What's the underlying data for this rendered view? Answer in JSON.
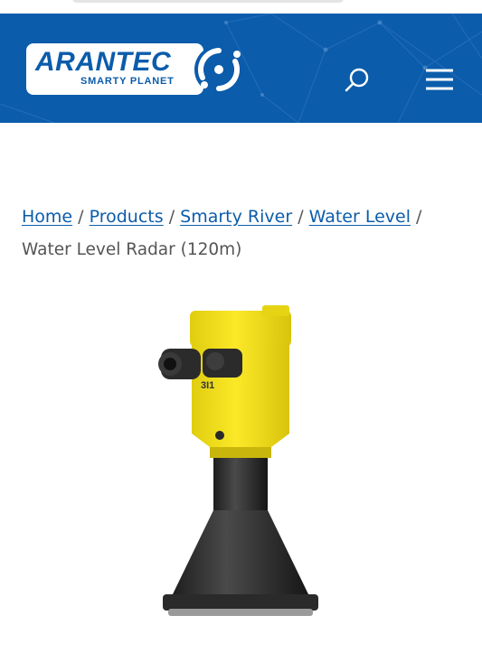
{
  "brand": {
    "name": "ARANTEC",
    "tagline": "SMARTY PLANET",
    "colors": {
      "primary": "#0b5cab",
      "background": "#ffffff",
      "accent_yellow": "#f6e21a"
    }
  },
  "header": {
    "icons": {
      "search": "search-icon",
      "menu": "hamburger-menu-icon"
    }
  },
  "breadcrumb": {
    "items": [
      {
        "label": "Home"
      },
      {
        "label": "Products"
      },
      {
        "label": "Smarty River"
      },
      {
        "label": "Water Level"
      }
    ],
    "separator": "/",
    "current": "Water Level Radar (120m)"
  },
  "product": {
    "label": "3I1"
  }
}
